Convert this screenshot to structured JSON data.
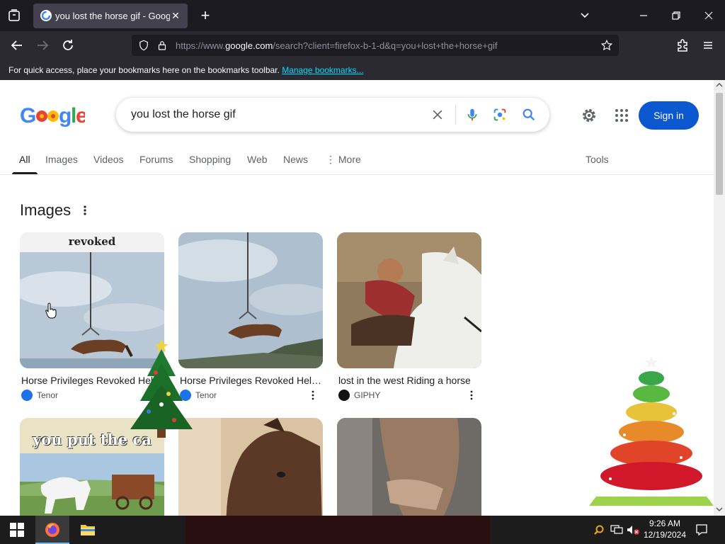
{
  "browser": {
    "tab_title": "you lost the horse gif - Google Search",
    "url_prefix": "https://www.",
    "url_domain": "google.com",
    "url_rest": "/search?client=firefox-b-1-d&q=you+lost+the+horse+gif",
    "bookmarks_text": "For quick access, place your bookmarks here on the bookmarks toolbar.",
    "bookmarks_link": "Manage bookmarks..."
  },
  "google": {
    "query": "you lost the horse gif",
    "sign_in": "Sign in",
    "tabs": [
      "All",
      "Images",
      "Videos",
      "Forums",
      "Shopping",
      "Web",
      "News",
      "More"
    ],
    "tools": "Tools",
    "images_title": "Images"
  },
  "images": [
    {
      "caption": "Horse Privileges Revoked Helicopter",
      "source": "Tenor",
      "overlay": "revoked",
      "src_color": "#1a73e8"
    },
    {
      "caption": "Horse Privileges Revoked Helicopter",
      "source": "Tenor",
      "overlay": "",
      "src_color": "#1a73e8"
    },
    {
      "caption": "lost in the west Riding a horse",
      "source": "GIPHY",
      "overlay": "",
      "src_color": "#121212"
    },
    {
      "caption": "",
      "source": "",
      "overlay": "you put the ca",
      "src_color": ""
    },
    {
      "caption": "",
      "source": "",
      "overlay": "",
      "src_color": ""
    },
    {
      "caption": "",
      "source": "",
      "overlay": "",
      "src_color": ""
    }
  ],
  "taskbar": {
    "time": "9:26 AM",
    "date": "12/19/2024"
  },
  "colors": {
    "accent": "#0b57d0",
    "tab_bg": "#42414d",
    "toolbar": "#2b2a33"
  }
}
